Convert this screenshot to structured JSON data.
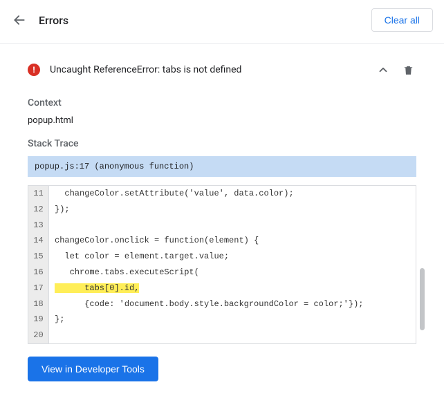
{
  "header": {
    "title": "Errors",
    "clear_all": "Clear all"
  },
  "error": {
    "message": "Uncaught ReferenceError: tabs is not defined"
  },
  "context": {
    "label": "Context",
    "value": "popup.html"
  },
  "stack": {
    "label": "Stack Trace",
    "header": "popup.js:17 (anonymous function)"
  },
  "code": {
    "lines": [
      {
        "n": "11",
        "text": "  changeColor.setAttribute('value', data.color);",
        "hl": false
      },
      {
        "n": "12",
        "text": "});",
        "hl": false
      },
      {
        "n": "13",
        "text": "",
        "hl": false
      },
      {
        "n": "14",
        "text": "changeColor.onclick = function(element) {",
        "hl": false
      },
      {
        "n": "15",
        "text": "  let color = element.target.value;",
        "hl": false
      },
      {
        "n": "16",
        "text": "   chrome.tabs.executeScript(",
        "hl": false
      },
      {
        "n": "17",
        "text": "      tabs[0].id,",
        "hl": true
      },
      {
        "n": "18",
        "text": "      {code: 'document.body.style.backgroundColor = color;'});",
        "hl": false
      },
      {
        "n": "19",
        "text": "};",
        "hl": false
      },
      {
        "n": "20",
        "text": "",
        "hl": false
      }
    ]
  },
  "footer": {
    "dev_tools": "View in Developer Tools"
  }
}
